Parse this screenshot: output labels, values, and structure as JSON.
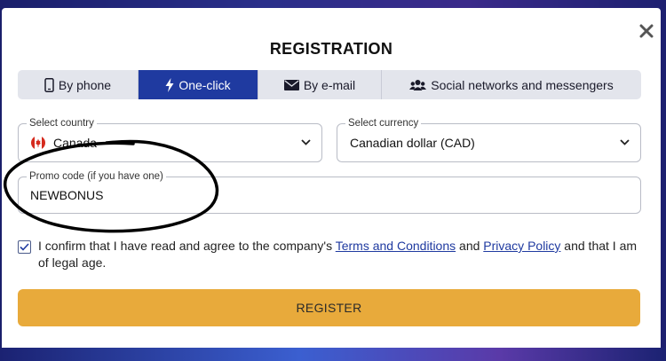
{
  "modal": {
    "title": "REGISTRATION",
    "close_icon": "close-icon"
  },
  "tabs": [
    {
      "label": "By phone",
      "icon": "phone-icon",
      "active": false
    },
    {
      "label": "One-click",
      "icon": "lightning-icon",
      "active": true
    },
    {
      "label": "By e-mail",
      "icon": "envelope-icon",
      "active": false
    },
    {
      "label": "Social networks and messengers",
      "icon": "users-icon",
      "active": false
    }
  ],
  "country": {
    "label": "Select country",
    "value": "Canada",
    "icon": "canada-flag-icon"
  },
  "currency": {
    "label": "Select currency",
    "value": "Canadian dollar (CAD)"
  },
  "promo": {
    "label": "Promo code (if you have one)",
    "value": "NEWBONUS"
  },
  "consent": {
    "checked": true,
    "text_before": "I confirm that I have read and agree to the company's ",
    "terms_link": "Terms and Conditions",
    "text_middle": " and ",
    "privacy_link": "Privacy Policy",
    "text_after": " and that I am of legal age."
  },
  "register_button": "REGISTER",
  "colors": {
    "active_tab": "#1f3aa0",
    "register_button": "#e8aa3b",
    "link": "#1f3aa0"
  }
}
